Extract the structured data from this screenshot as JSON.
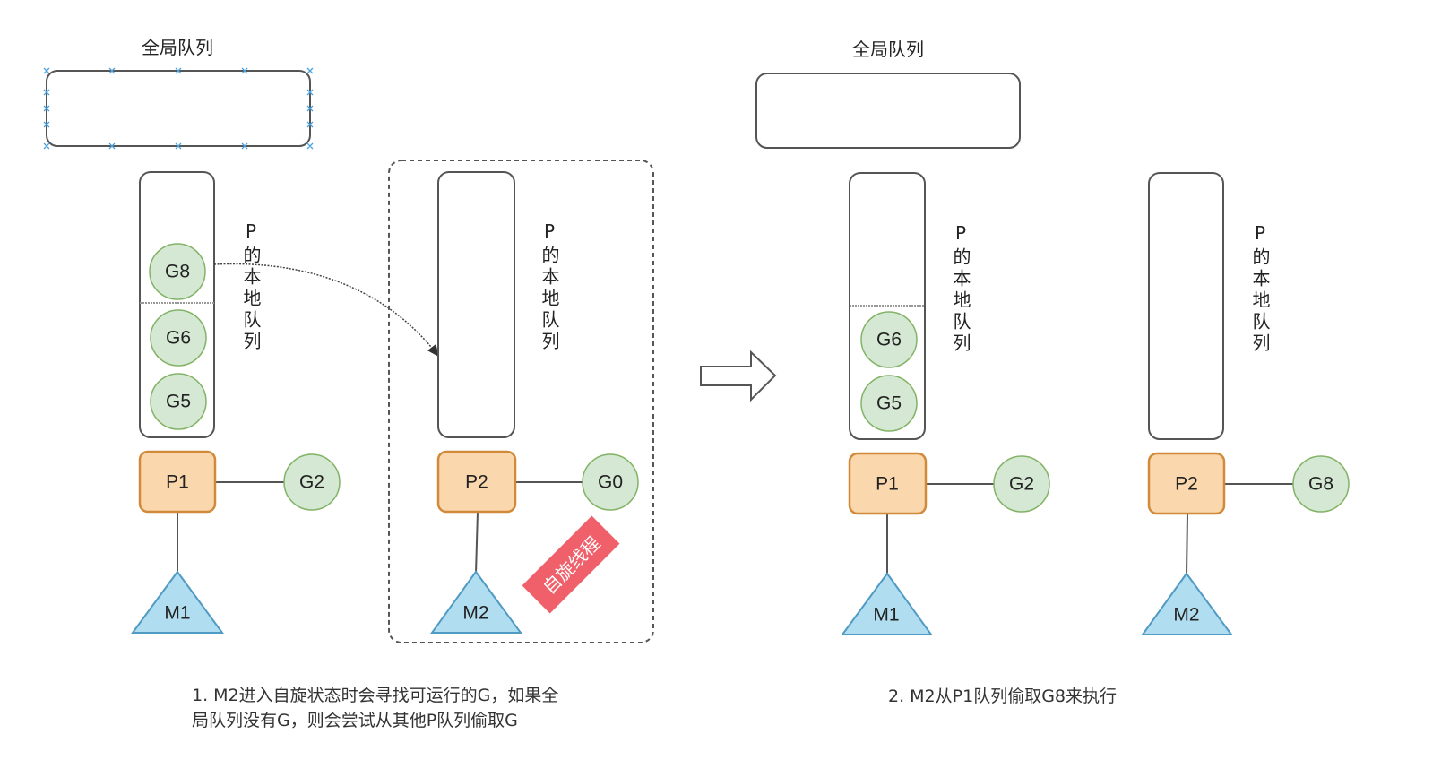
{
  "colors": {
    "g_fill": "#d5e8d4",
    "g_stroke": "#82b366",
    "p_fill": "#fad7ac",
    "p_stroke": "#d08a3a",
    "m_fill": "#b1ddf0",
    "m_stroke": "#4f9bc4",
    "badge": "#f0606a"
  },
  "left": {
    "global_queue_title": "全局队列",
    "p1": {
      "label": "P1",
      "queue_label": "P的本地队列",
      "queue": [
        "G8",
        "G6",
        "G5"
      ],
      "running": "G2",
      "m": "M1"
    },
    "p2": {
      "label": "P2",
      "queue_label": "P的本地队列",
      "queue": [],
      "running": "G0",
      "m": "M2",
      "badge": "自旋线程"
    },
    "caption_line1": "1. M2进入自旋状态时会寻找可运行的G，如果全",
    "caption_line2": "局队列没有G，则会尝试从其他P队列偷取G"
  },
  "right": {
    "global_queue_title": "全局队列",
    "p1": {
      "label": "P1",
      "queue_label": "P的本地队列",
      "queue": [
        "G6",
        "G5"
      ],
      "running": "G2",
      "m": "M1"
    },
    "p2": {
      "label": "P2",
      "queue_label": "P的本地队列",
      "queue": [],
      "running": "G8",
      "m": "M2"
    },
    "caption": "2. M2从P1队列偷取G8来执行"
  }
}
